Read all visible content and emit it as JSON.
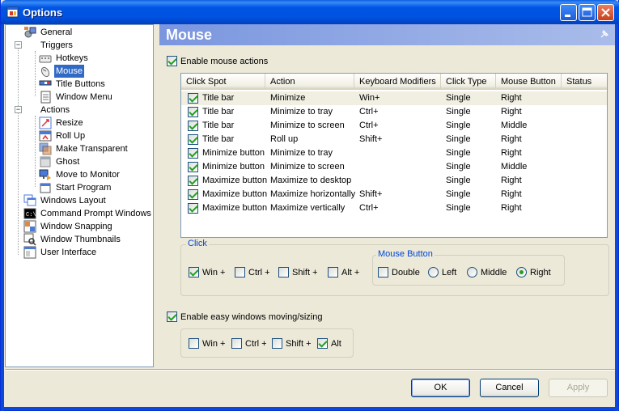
{
  "window": {
    "title": "Options"
  },
  "tree": {
    "items": [
      {
        "label": "General",
        "level": 1,
        "icon": "general-settings-icon"
      },
      {
        "label": "Triggers",
        "level": 1,
        "icon": "none",
        "expanded": true
      },
      {
        "label": "Hotkeys",
        "level": 2,
        "icon": "keyboard-icon"
      },
      {
        "label": "Mouse",
        "level": 2,
        "icon": "mouse-icon",
        "selected": true
      },
      {
        "label": "Title Buttons",
        "level": 2,
        "icon": "title-buttons-icon"
      },
      {
        "label": "Window Menu",
        "level": 2,
        "icon": "window-menu-icon"
      },
      {
        "label": "Actions",
        "level": 1,
        "icon": "none",
        "expanded": true
      },
      {
        "label": "Resize",
        "level": 2,
        "icon": "resize-icon"
      },
      {
        "label": "Roll Up",
        "level": 2,
        "icon": "roll-up-icon"
      },
      {
        "label": "Make Transparent",
        "level": 2,
        "icon": "transparent-icon"
      },
      {
        "label": "Ghost",
        "level": 2,
        "icon": "ghost-icon"
      },
      {
        "label": "Move to Monitor",
        "level": 2,
        "icon": "monitor-icon"
      },
      {
        "label": "Start Program",
        "level": 2,
        "icon": "program-icon"
      },
      {
        "label": "Windows Layout",
        "level": 1,
        "icon": "windows-layout-icon"
      },
      {
        "label": "Command Prompt Windows",
        "level": 1,
        "icon": "command-prompt-icon"
      },
      {
        "label": "Window Snapping",
        "level": 1,
        "icon": "window-snapping-icon"
      },
      {
        "label": "Window Thumbnails",
        "level": 1,
        "icon": "window-thumbnails-icon"
      },
      {
        "label": "User Interface",
        "level": 1,
        "icon": "user-interface-icon"
      }
    ]
  },
  "panel": {
    "title": "Mouse",
    "enable_mouse_actions": {
      "label": "Enable mouse actions",
      "checked": true
    },
    "table": {
      "columns": [
        "Click Spot",
        "Action",
        "Keyboard Modifiers",
        "Click Type",
        "Mouse Button",
        "Status"
      ],
      "rows": [
        {
          "checked": true,
          "spot": "Title bar",
          "action": "Minimize",
          "mods": "Win+",
          "type": "Single",
          "button": "Right",
          "status": ""
        },
        {
          "checked": true,
          "spot": "Title bar",
          "action": "Minimize to tray",
          "mods": "Ctrl+",
          "type": "Single",
          "button": "Right",
          "status": ""
        },
        {
          "checked": true,
          "spot": "Title bar",
          "action": "Minimize to screen",
          "mods": "Ctrl+",
          "type": "Single",
          "button": "Middle",
          "status": ""
        },
        {
          "checked": true,
          "spot": "Title bar",
          "action": "Roll up",
          "mods": "Shift+",
          "type": "Single",
          "button": "Right",
          "status": ""
        },
        {
          "checked": true,
          "spot": "Minimize button",
          "action": "Minimize to tray",
          "mods": "",
          "type": "Single",
          "button": "Right",
          "status": ""
        },
        {
          "checked": true,
          "spot": "Minimize button",
          "action": "Minimize to screen",
          "mods": "",
          "type": "Single",
          "button": "Middle",
          "status": ""
        },
        {
          "checked": true,
          "spot": "Maximize button",
          "action": "Maximize to desktop",
          "mods": "",
          "type": "Single",
          "button": "Right",
          "status": ""
        },
        {
          "checked": true,
          "spot": "Maximize button",
          "action": "Maximize horizontally",
          "mods": "Shift+",
          "type": "Single",
          "button": "Right",
          "status": ""
        },
        {
          "checked": true,
          "spot": "Maximize button",
          "action": "Maximize vertically",
          "mods": "Ctrl+",
          "type": "Single",
          "button": "Right",
          "status": ""
        }
      ]
    },
    "click_group": {
      "label": "Click",
      "modifiers": [
        {
          "label": "Win +",
          "checked": true
        },
        {
          "label": "Ctrl +",
          "checked": false
        },
        {
          "label": "Shift +",
          "checked": false
        },
        {
          "label": "Alt +",
          "checked": false
        }
      ],
      "mouse_button": {
        "label": "Mouse Button",
        "double": {
          "label": "Double",
          "checked": false
        },
        "options": [
          {
            "label": "Left",
            "selected": false
          },
          {
            "label": "Middle",
            "selected": false
          },
          {
            "label": "Right",
            "selected": true
          }
        ]
      }
    },
    "easy_move": {
      "label": "Enable easy windows moving/sizing",
      "checked": true,
      "modifiers": [
        {
          "label": "Win +",
          "checked": false
        },
        {
          "label": "Ctrl +",
          "checked": false
        },
        {
          "label": "Shift +",
          "checked": false
        },
        {
          "label": "Alt",
          "checked": true
        }
      ]
    }
  },
  "buttons": {
    "ok": "OK",
    "cancel": "Cancel",
    "apply": "Apply"
  }
}
